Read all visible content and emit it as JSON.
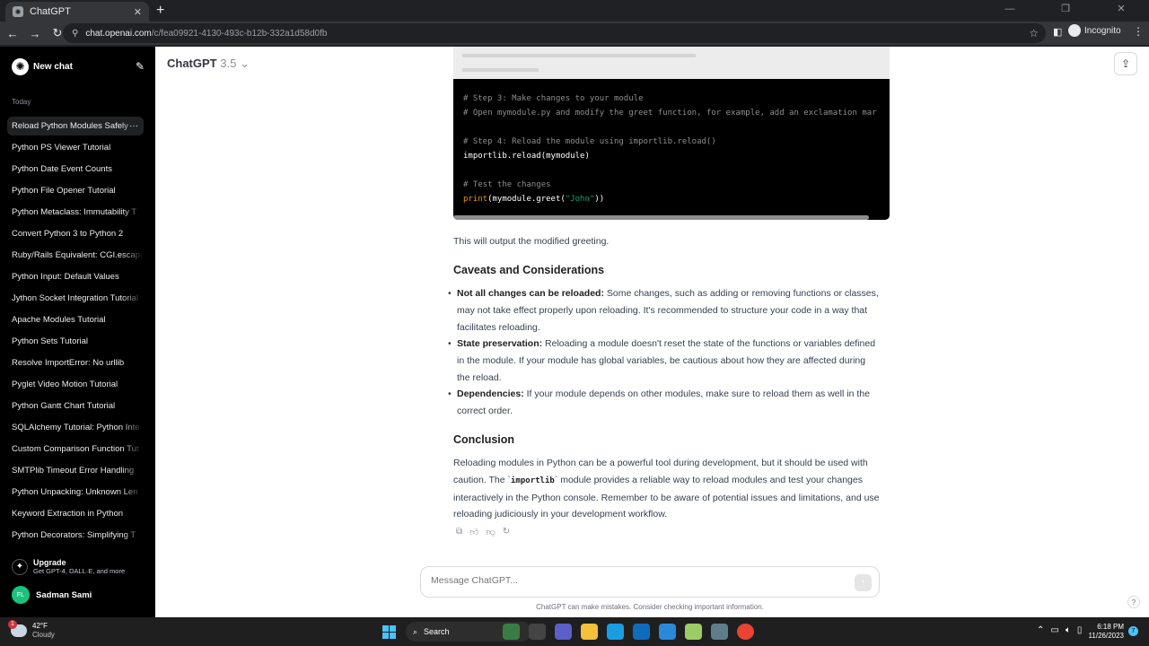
{
  "browser": {
    "tab_title": "ChatGPT",
    "url_host": "chat.openai.com",
    "url_path": "/c/fea09921-4130-493c-b12b-332a1d58d0fb",
    "profile": "Incognito"
  },
  "sidebar": {
    "new_chat": "New chat",
    "section_label": "Today",
    "items": [
      {
        "label": "Reload Python Modules Safely"
      },
      {
        "label": "Python PS Viewer Tutorial"
      },
      {
        "label": "Python Date Event Counts"
      },
      {
        "label": "Python File Opener Tutorial"
      },
      {
        "label": "Python Metaclass: Immutability T"
      },
      {
        "label": "Convert Python 3 to Python 2"
      },
      {
        "label": "Ruby/Rails Equivalent: CGI.escape"
      },
      {
        "label": "Python Input: Default Values"
      },
      {
        "label": "Jython Socket Integration Tutorial"
      },
      {
        "label": "Apache Modules Tutorial"
      },
      {
        "label": "Python Sets Tutorial"
      },
      {
        "label": "Resolve ImportError: No urllib"
      },
      {
        "label": "Pyglet Video Motion Tutorial"
      },
      {
        "label": "Python Gantt Chart Tutorial"
      },
      {
        "label": "SQLAlchemy Tutorial: Python Inte"
      },
      {
        "label": "Custom Comparison Function Tut"
      },
      {
        "label": "SMTPlib Timeout Error Handling"
      },
      {
        "label": "Python Unpacking: Unknown Len"
      },
      {
        "label": "Keyword Extraction in Python"
      },
      {
        "label": "Python Decorators: Simplifying T"
      }
    ],
    "upgrade_title": "Upgrade",
    "upgrade_subtitle": "Get GPT-4, DALL·E, and more",
    "user_initials": "FL",
    "user_name": "Sadman Sami"
  },
  "header": {
    "model": "ChatGPT",
    "version": "3.5"
  },
  "code": {
    "lines": [
      {
        "text": "# Step 3: Make changes to your module",
        "kind": "comment"
      },
      {
        "text": "# Open mymodule.py and modify the greet function, for example, add an exclamation mar",
        "kind": "comment"
      },
      {
        "text": "",
        "kind": "blank"
      },
      {
        "text": "# Step 4: Reload the module using importlib.reload()",
        "kind": "comment"
      },
      {
        "text": "importlib.reload(mymodule)",
        "kind": "code"
      },
      {
        "text": "",
        "kind": "blank"
      },
      {
        "text": "# Test the changes",
        "kind": "comment"
      }
    ],
    "print_fn": "print",
    "print_pre": "(mymodule.greet(",
    "print_str": "\"John\"",
    "print_post": "))"
  },
  "content": {
    "output_note": "This will output the modified greeting.",
    "caveats_heading": "Caveats and Considerations",
    "bullets": [
      {
        "title": "Not all changes can be reloaded:",
        "text": " Some changes, such as adding or removing functions or classes, may not take effect properly upon reloading. It's recommended to structure your code in a way that facilitates reloading."
      },
      {
        "title": "State preservation:",
        "text": " Reloading a module doesn't reset the state of the functions or variables defined in the module. If your module has global variables, be cautious about how they are affected during the reload."
      },
      {
        "title": "Dependencies:",
        "text": " If your module depends on other modules, make sure to reload them as well in the correct order."
      }
    ],
    "conclusion_heading": "Conclusion",
    "conclusion_pre": "Reloading modules in Python can be a powerful tool during development, but it should be used with caution. The `",
    "conclusion_code": "importlib",
    "conclusion_post": "` module provides a reliable way to reload modules and test your changes interactively in the Python console. Remember to be aware of potential issues and limitations, and use reloading judiciously in your development workflow."
  },
  "composer": {
    "placeholder": "Message ChatGPT...",
    "disclaimer": "ChatGPT can make mistakes. Consider checking important information."
  },
  "taskbar": {
    "weather_badge": "1",
    "temperature": "42°F",
    "weather": "Cloudy",
    "search": "Search",
    "time": "6:18 PM",
    "date": "11/26/2023",
    "notifications": "7"
  },
  "icons": [
    "openai-logo-icon",
    "edit-icon",
    "share-icon",
    "copy-icon",
    "thumbs-up-icon",
    "thumbs-down-icon",
    "regenerate-icon",
    "send-icon",
    "help-icon"
  ]
}
